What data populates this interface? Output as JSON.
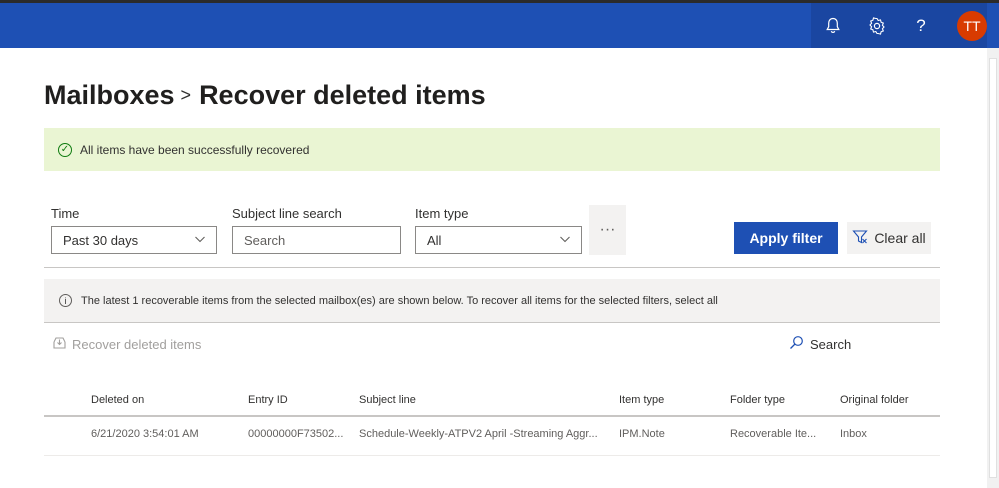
{
  "topbar": {
    "icons": [
      "bell-icon",
      "gear-icon",
      "help-icon"
    ],
    "avatar_initials": "TT"
  },
  "breadcrumb": {
    "parent": "Mailboxes",
    "separator": ">",
    "current": "Recover deleted items"
  },
  "banner": {
    "message": "All items have been successfully recovered"
  },
  "filters": {
    "time": {
      "label": "Time",
      "value": "Past 30 days"
    },
    "subject": {
      "label": "Subject line search",
      "placeholder": "Search"
    },
    "item_type": {
      "label": "Item type",
      "value": "All"
    },
    "more_label": "···",
    "apply_label": "Apply filter",
    "clear_label": "Clear all"
  },
  "info": {
    "message": "The latest 1 recoverable items from the selected mailbox(es) are shown below. To recover all items for the selected filters, select all"
  },
  "commands": {
    "recover_label": "Recover deleted items",
    "search_label": "Search"
  },
  "table": {
    "columns": [
      "Deleted on",
      "Entry ID",
      "Subject line",
      "Item type",
      "Folder type",
      "Original folder"
    ],
    "rows": [
      [
        "6/21/2020 3:54:01 AM",
        "00000000F73502...",
        "Schedule-Weekly-ATPV2 April -Streaming Aggr...",
        "IPM.Note",
        "Recoverable Ite...",
        "Inbox"
      ]
    ]
  }
}
